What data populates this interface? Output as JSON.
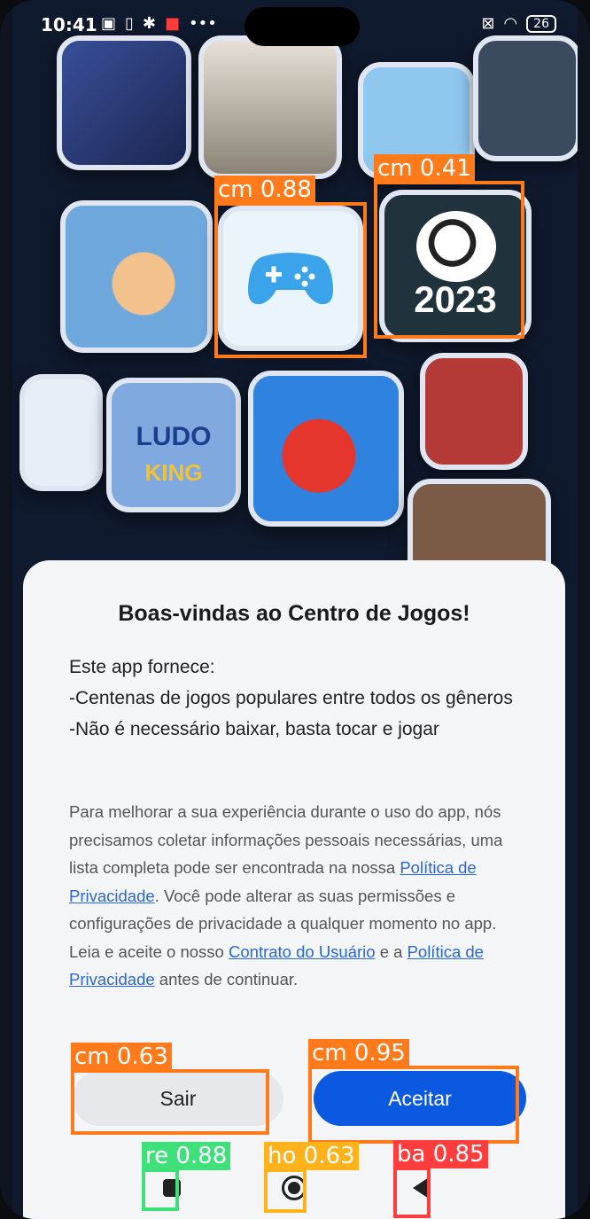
{
  "status_bar": {
    "time": "10:41",
    "battery": "26"
  },
  "dialog": {
    "title": "Boas-vindas ao Centro de Jogos!",
    "intro": "Este app fornece:",
    "bullets": [
      "-Centenas de jogos populares entre todos os gêneros",
      "-Não é necessário baixar, basta tocar e jogar"
    ],
    "para_1": "Para melhorar a sua experiência durante o uso do app, nós precisamos coletar informações pessoais necessárias, uma lista completa pode ser encontrada na nossa ",
    "link_privacy_1": "Política de Privacidade",
    "para_2": ". Você pode alterar as suas permissões e configurações de privacidade a qualquer momento no app. Leia e aceite o nosso ",
    "link_contract": "Contrato do Usuário",
    "para_3": " e a ",
    "link_privacy_2": "Política de Privacidade",
    "para_4": " antes de continuar.",
    "btn_exit": "Sair",
    "btn_accept": "Aceitar"
  },
  "wallpaper": {
    "tile_football_text": "2023",
    "tile_ludo_text_1": "LUDO",
    "tile_ludo_text_2": "KING"
  },
  "detections": [
    {
      "label": "cm 0.88",
      "color": "orange"
    },
    {
      "label": "cm 0.41",
      "color": "orange"
    },
    {
      "label": "cm 0.63",
      "color": "orange"
    },
    {
      "label": "cm 0.95",
      "color": "orange"
    },
    {
      "label": "re 0.88",
      "color": "green"
    },
    {
      "label": "ho 0.63",
      "color": "yellow"
    },
    {
      "label": "ba 0.85",
      "color": "red"
    }
  ],
  "colors": {
    "accent_blue": "#0a59e0",
    "link_blue": "#2a66d6",
    "det_orange": "#ff7a1a",
    "det_green": "#3ee07a",
    "det_yellow": "#ffb21a",
    "det_red": "#ff3d3d"
  }
}
